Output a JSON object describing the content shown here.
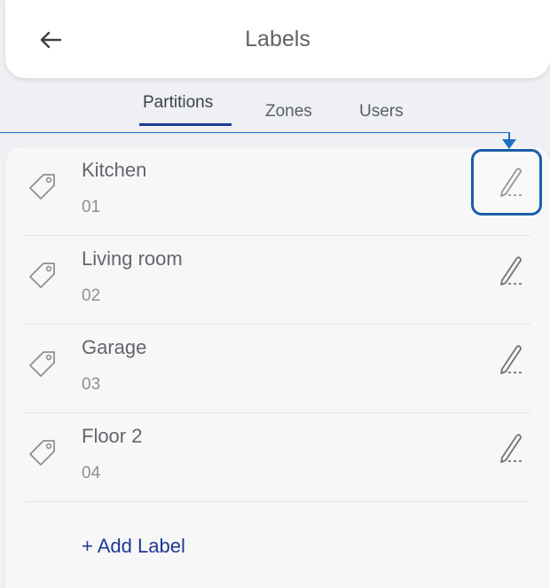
{
  "header": {
    "title": "Labels",
    "back_icon": "arrow-left-icon"
  },
  "tabs": [
    {
      "label": "Partitions",
      "active": true
    },
    {
      "label": "Zones",
      "active": false
    },
    {
      "label": "Users",
      "active": false
    }
  ],
  "labels": [
    {
      "name": "Kitchen",
      "number": "01"
    },
    {
      "name": "Living room",
      "number": "02"
    },
    {
      "name": "Garage",
      "number": "03"
    },
    {
      "name": "Floor 2",
      "number": "04"
    }
  ],
  "add_label": "+ Add Label",
  "colors": {
    "accent": "#1f3a93",
    "callout": "#1a5ea8",
    "text": "#62666c",
    "subtext": "#8c9096"
  }
}
